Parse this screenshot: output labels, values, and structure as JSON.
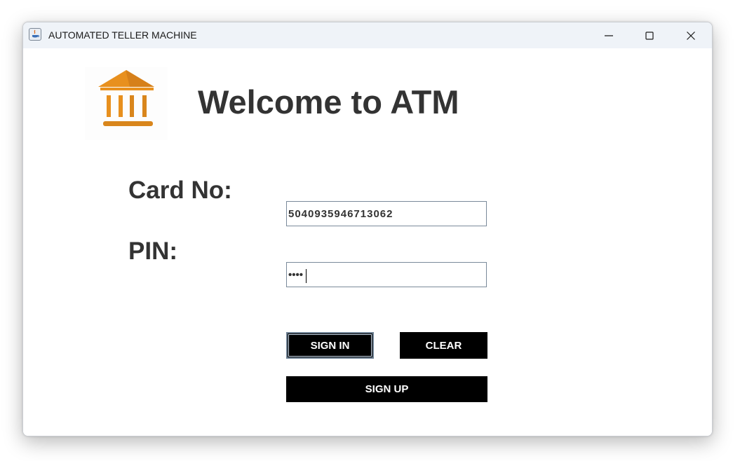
{
  "window": {
    "title": "AUTOMATED TELLER MACHINE",
    "icon": "java-icon",
    "controls": [
      "minimize-icon",
      "maximize-icon",
      "close-icon"
    ]
  },
  "header": {
    "logo_icon": "bank-icon",
    "logo_color": "#E8901E",
    "welcome_text": "Welcome to ATM"
  },
  "form": {
    "card_label": "Card No:",
    "card_value": "5040935946713062",
    "pin_label": "PIN:",
    "pin_value": "••••"
  },
  "buttons": {
    "sign_in": "SIGN IN",
    "clear": "CLEAR",
    "sign_up": "SIGN UP"
  },
  "colors": {
    "button_bg": "#000000",
    "button_text": "#FFFFFF",
    "label_text": "#333333",
    "titlebar_bg": "#EFF3F8"
  }
}
